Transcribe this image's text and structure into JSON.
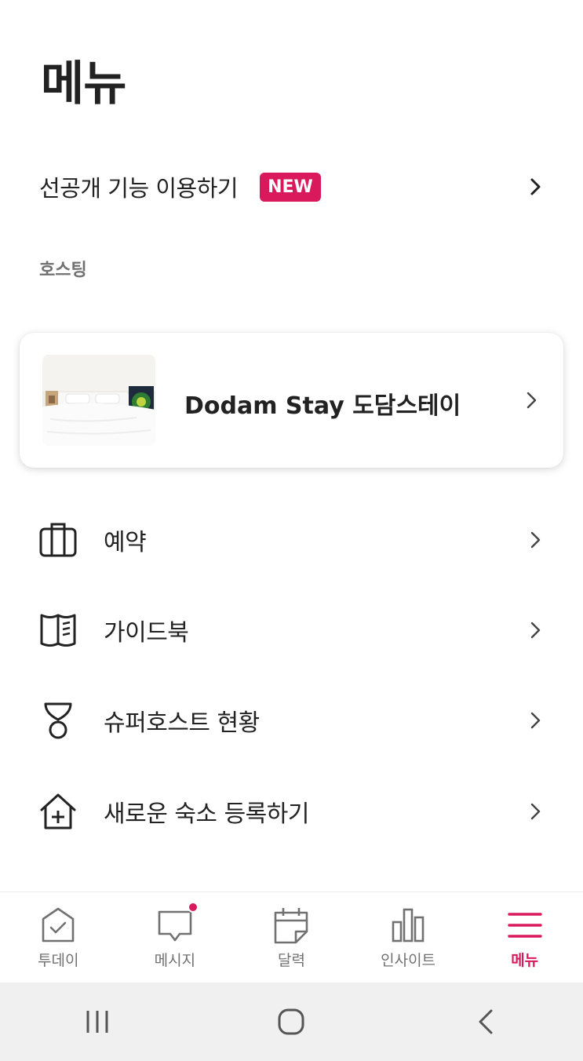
{
  "page": {
    "title": "메뉴"
  },
  "preview": {
    "label": "선공개 기능 이용하기",
    "badge": "NEW"
  },
  "hosting_section": {
    "label": "호스팅"
  },
  "listing": {
    "name": "Dodam Stay 도담스테이"
  },
  "menu_items": [
    {
      "label": "예약",
      "icon": "suitcase-icon"
    },
    {
      "label": "가이드북",
      "icon": "guidebook-icon"
    },
    {
      "label": "슈퍼호스트 현황",
      "icon": "medal-icon"
    },
    {
      "label": "새로운 숙소 등록하기",
      "icon": "house-plus-icon"
    }
  ],
  "tabbar": {
    "tabs": [
      {
        "label": "투데이",
        "icon": "today-check-icon",
        "active": false
      },
      {
        "label": "메시지",
        "icon": "message-icon",
        "active": false,
        "has_notification": true
      },
      {
        "label": "달력",
        "icon": "calendar-icon",
        "active": false
      },
      {
        "label": "인사이트",
        "icon": "insights-icon",
        "active": false
      },
      {
        "label": "메뉴",
        "icon": "menu-icon",
        "active": true
      }
    ]
  },
  "colors": {
    "accent": "#d9195b",
    "text": "#222222",
    "muted": "#717171",
    "system_bar": "#f0f0f0"
  },
  "system_nav": {
    "buttons": [
      "recent-apps-icon",
      "home-icon",
      "back-icon"
    ]
  }
}
